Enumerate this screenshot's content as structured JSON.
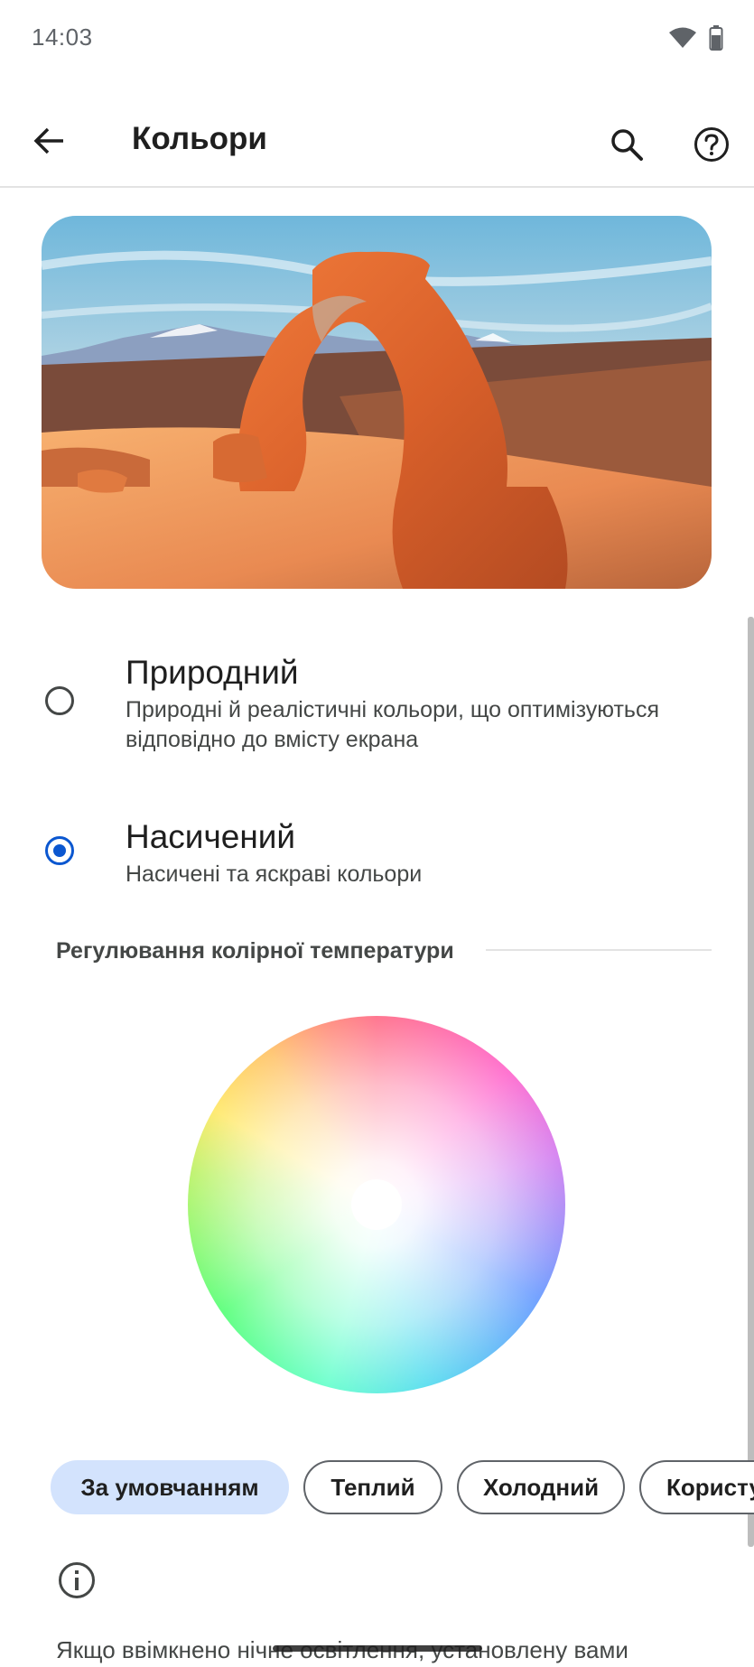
{
  "status_bar": {
    "time": "14:03",
    "icons": [
      "wifi-icon",
      "battery-icon"
    ]
  },
  "app_bar": {
    "title": "Кольори",
    "icons": [
      "back-arrow-icon",
      "search-icon",
      "help-icon"
    ]
  },
  "hero": {
    "image": "arch-landscape-photo"
  },
  "options": [
    {
      "title": "Природний",
      "subtitle": "Природні й реалістичні кольори, що оптимізуються відповідно до вмісту екрана",
      "selected": false
    },
    {
      "title": "Насичений",
      "subtitle": "Насичені та яскраві кольори",
      "selected": true
    }
  ],
  "temperature": {
    "header": "Регулювання колірної температури",
    "presets": [
      {
        "label": "За умовчанням",
        "selected": true
      },
      {
        "label": "Теплий",
        "selected": false
      },
      {
        "label": "Холодний",
        "selected": false
      },
      {
        "label": "Користу",
        "selected": false
      }
    ]
  },
  "info": {
    "icon": "info-icon",
    "text": "Якщо ввімкнено нічне освітлення, установлену вами"
  },
  "colors": {
    "accent": "#0b57d0",
    "chip_selected_bg": "#d3e3fd"
  }
}
